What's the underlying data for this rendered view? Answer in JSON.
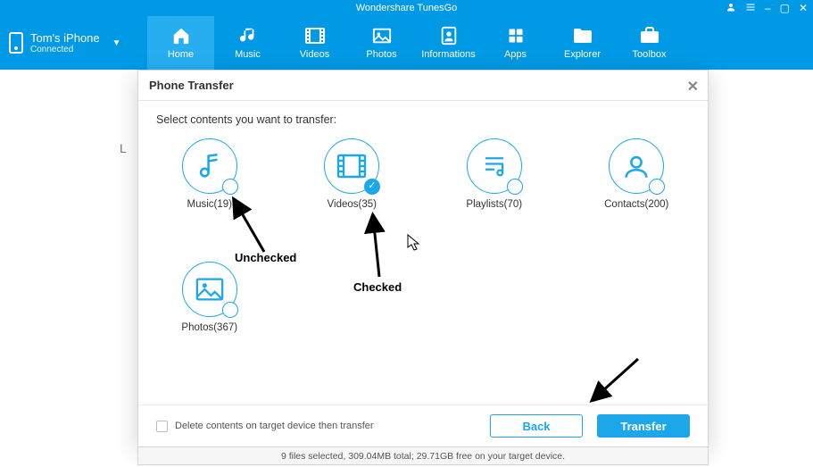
{
  "app_title": "Wondershare TunesGo",
  "device": {
    "name": "Tom's iPhone",
    "status": "Connected"
  },
  "nav": {
    "items": [
      {
        "label": "Home",
        "active": true
      },
      {
        "label": "Music"
      },
      {
        "label": "Videos"
      },
      {
        "label": "Photos"
      },
      {
        "label": "Informations"
      },
      {
        "label": "Apps"
      },
      {
        "label": "Explorer"
      },
      {
        "label": "Toolbox"
      }
    ]
  },
  "modal": {
    "title": "Phone Transfer",
    "instruction": "Select contents you want to transfer:",
    "items": [
      {
        "label": "Music(19)",
        "checked": false,
        "icon": "music-note-icon"
      },
      {
        "label": "Videos(35)",
        "checked": true,
        "icon": "film-icon"
      },
      {
        "label": "Playlists(70)",
        "checked": false,
        "icon": "playlist-icon"
      },
      {
        "label": "Contacts(200)",
        "checked": false,
        "icon": "contact-icon"
      },
      {
        "label": "Photos(367)",
        "checked": false,
        "icon": "photo-icon"
      }
    ],
    "delete_label": "Delete contents on target device then transfer",
    "back": "Back",
    "transfer": "Transfer"
  },
  "status_line": "9 files selected, 309.04MB total; 29.71GB free on your target device.",
  "annotations": {
    "unchecked": "Unchecked",
    "checked": "Checked"
  }
}
